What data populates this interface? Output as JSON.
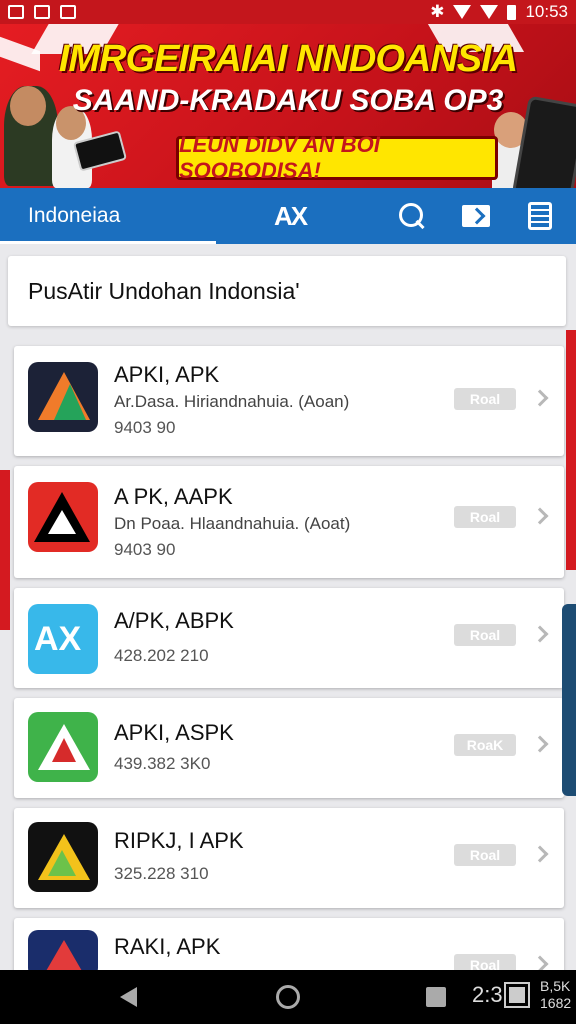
{
  "status_bar": {
    "time": "10:53",
    "icons": [
      "notification-icon",
      "photo-icon",
      "mail-icon",
      "bluetooth-icon",
      "wifi-icon",
      "signal-icon",
      "battery-icon"
    ]
  },
  "banner": {
    "title_line1": "IMRGEIRAIAI NNDOANSIA",
    "title_line2": "SAAND-KRADAKU SOBA OP3",
    "cta": "LEUN DIDV AN BOI SOOBODISA!"
  },
  "nav": {
    "tab_label": "Indoneiaa",
    "logo": "AX",
    "icons": [
      "search-icon",
      "mail-icon",
      "menu-icon"
    ]
  },
  "header_card": {
    "title": "PusAtir Undohan Indonsia'"
  },
  "apps": [
    {
      "name": "APKI, APK",
      "desc": "Ar.Dasa. Hiriandnahuia. (Aoan)",
      "meta": "9403 90",
      "button": "Roal",
      "icon_color": "#1c2237"
    },
    {
      "name": "A PK, AAPK",
      "desc": "Dn Poaa. Hlaandnahuia. (Aoat)",
      "meta": "9403 90",
      "button": "Roal",
      "icon_color": "#e22b25"
    },
    {
      "name": "A/PK, ABPK",
      "desc": "",
      "meta": "428.202 210",
      "button": "Roal",
      "icon_color": "#38b8ea"
    },
    {
      "name": "APKI, ASPK",
      "desc": "",
      "meta": "439.382 3K0",
      "button": "RoaK",
      "icon_color": "#3fb34a"
    },
    {
      "name": "RIPKJ, I APK",
      "desc": "",
      "meta": "325.228 310",
      "button": "Roal",
      "icon_color": "#111111"
    },
    {
      "name": "RAKI, APK",
      "desc": "",
      "meta": "",
      "button": "Roal",
      "icon_color": "#1a2d6b"
    }
  ],
  "system_nav": {
    "right_text": "2:3",
    "tiny_line1": "B,5K",
    "tiny_line2": "1682"
  },
  "colors": {
    "header_blue": "#1b6fbf",
    "banner_red": "#c4161c",
    "banner_yellow": "#ffe600"
  }
}
